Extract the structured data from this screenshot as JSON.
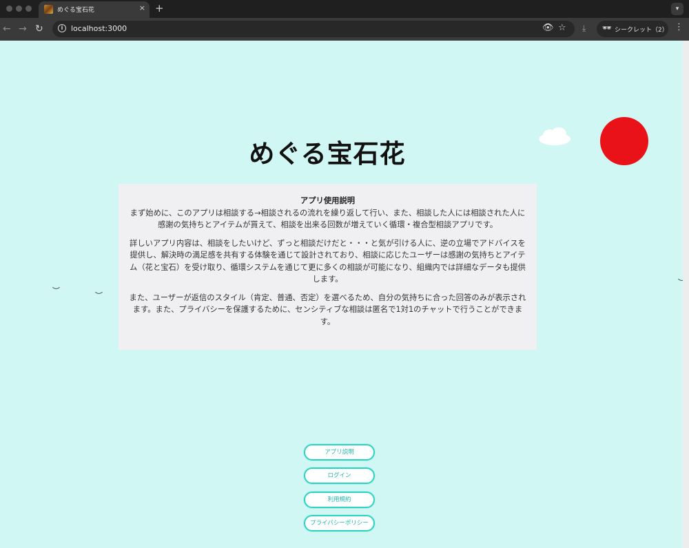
{
  "browser": {
    "tab_title": "めぐる宝石花",
    "tab_close": "×",
    "new_tab": "+",
    "url": "localhost:3000",
    "incognito_label": "シークレット（2）",
    "icons": [
      "back-icon",
      "forward-icon",
      "reload-icon",
      "info-icon",
      "eye-icon",
      "star-icon",
      "download-icon",
      "incognito-icon",
      "kebab-menu-icon",
      "chevron-down-icon"
    ]
  },
  "page": {
    "title": "めぐる宝石花",
    "card": {
      "heading": "アプリ使用説明",
      "para1": "まず始めに、このアプリは相談する→相談されるの流れを繰り返して行い、また、相談した人には相談された人に感謝の気持ちとアイテムが貰えて、相談を出来る回数が増えていく循環・複合型相談アプリです。",
      "para2": "詳しいアプリ内容は、相談をしたいけど、ずっと相談だけだと・・・と気が引ける人に、逆の立場でアドバイスを提供し、解決時の満足感を共有する体験を通じて設計されており、相談に応じたユーザーは感謝の気持ちとアイテム（花と宝石）を受け取り、循環システムを通じて更に多くの相談が可能になり、組織内では詳細なデータも提供します。",
      "para3": "また、ユーザーが返信のスタイル（肯定、普通、否定）を選べるため、自分の気持ちに合った回答のみが表示されます。また、プライバシーを保護するために、センシティブな相談は匿名で1対1のチャットで行うことができます。"
    },
    "buttons": {
      "about": "アプリ説明",
      "login": "ログイン",
      "terms": "利用規約",
      "privacy": "プライバシーポリシー"
    },
    "colors": {
      "background": "#d0f7f3",
      "sun": "#e81218",
      "button_border": "#2bd4c2",
      "button_text": "#19b9a8"
    }
  }
}
